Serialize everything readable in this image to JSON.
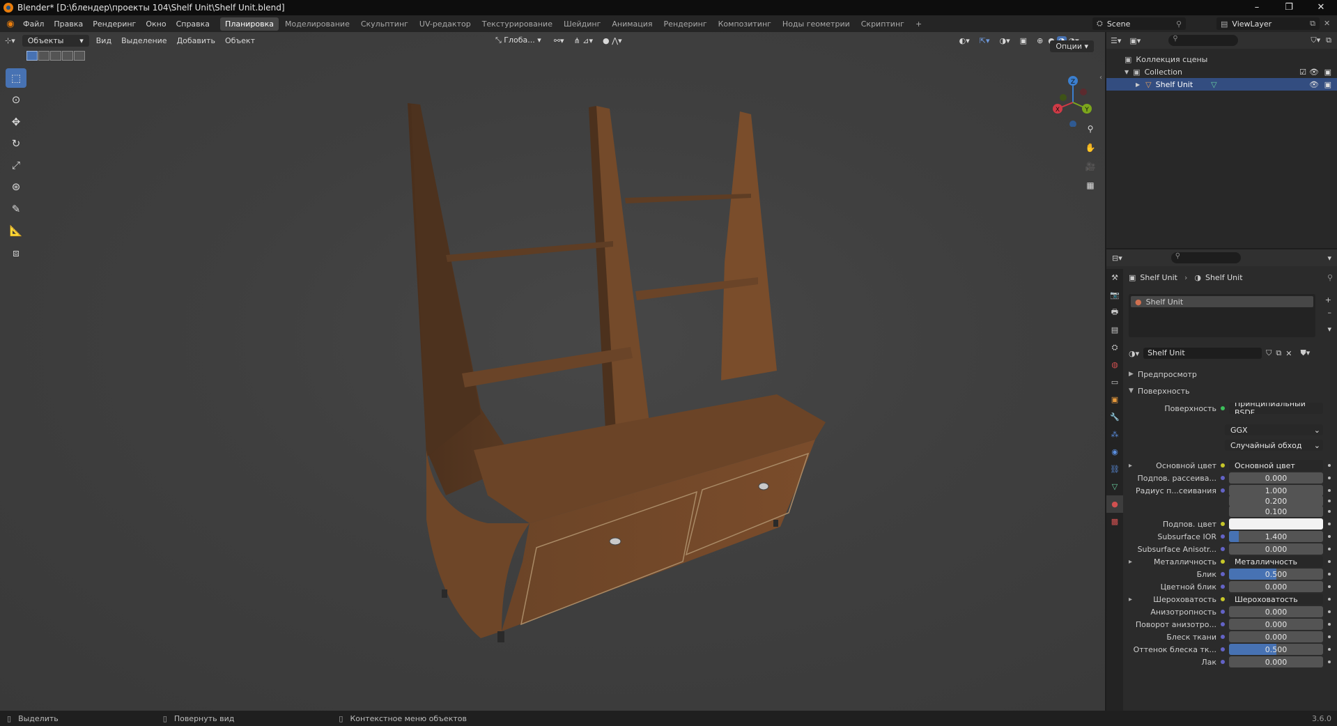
{
  "title": "Blender* [D:\\блендер\\проекты 104\\Shelf Unit\\Shelf Unit.blend]",
  "window_buttons": [
    "–",
    "❐",
    "✕"
  ],
  "menu": [
    "Файл",
    "Правка",
    "Рендеринг",
    "Окно",
    "Справка"
  ],
  "workspaces": [
    "Планировка",
    "Моделирование",
    "Скульптинг",
    "UV-редактор",
    "Текстурирование",
    "Шейдинг",
    "Анимация",
    "Рендеринг",
    "Композитинг",
    "Ноды геометрии",
    "Скриптинг",
    "+"
  ],
  "active_workspace_index": 0,
  "scene": {
    "name": "Scene",
    "view_layer": "ViewLayer"
  },
  "viewport": {
    "mode": "Объекты",
    "menus": [
      "Вид",
      "Выделение",
      "Добавить",
      "Объект"
    ],
    "transform_orientation": "Глоба...",
    "options_label": "Опции",
    "gizmo_axes": {
      "x": "X",
      "y": "Y",
      "z": "Z"
    },
    "colors": {
      "x": "#d03a46",
      "y": "#7ca61c",
      "z": "#3b7fcf"
    }
  },
  "tools": [
    "select-box-icon",
    "cursor-icon",
    "move-icon",
    "rotate-icon",
    "scale-icon",
    "transform-icon",
    "annotate-icon",
    "measure-icon",
    "add-cube-icon"
  ],
  "outliner": {
    "root": "Коллекция сцены",
    "collection": "Collection",
    "object": "Shelf Unit"
  },
  "properties": {
    "breadcrumb": [
      "Shelf Unit",
      "Shelf Unit"
    ],
    "material_slot": "Shelf Unit",
    "material_name": "Shelf Unit",
    "panels": {
      "preview": "Предпросмотр",
      "surface": "Поверхность"
    },
    "surface_label": "Поверхность",
    "surface_shader": "Принципиальный BSDF",
    "distribution": "GGX",
    "subsurface_method": "Случайный обход",
    "rows": [
      {
        "label": "Основной цвет",
        "value": "Основной цвет",
        "type": "link",
        "expand": true
      },
      {
        "label": "Подпов. рассеива...",
        "value": "0.000",
        "type": "num",
        "fill": 0
      },
      {
        "label": "Радиус п...сеивания",
        "value": "1.000",
        "type": "num",
        "fill": 0
      },
      {
        "label": "",
        "value": "0.200",
        "type": "num",
        "fill": 0
      },
      {
        "label": "",
        "value": "0.100",
        "type": "num",
        "fill": 0
      },
      {
        "label": "Подпов. цвет",
        "value": "",
        "type": "color",
        "fill": 0
      },
      {
        "label": "Subsurface IOR",
        "value": "1.400",
        "type": "num",
        "fill": 0.1
      },
      {
        "label": "Subsurface Anisotr...",
        "value": "0.000",
        "type": "num",
        "fill": 0
      },
      {
        "label": "Металличность",
        "value": "Металличность",
        "type": "link",
        "expand": true
      },
      {
        "label": "Блик",
        "value": "0.500",
        "type": "num",
        "fill": 0.5
      },
      {
        "label": "Цветной блик",
        "value": "0.000",
        "type": "num",
        "fill": 0
      },
      {
        "label": "Шероховатость",
        "value": "Шероховатость",
        "type": "link",
        "expand": true
      },
      {
        "label": "Анизотропность",
        "value": "0.000",
        "type": "num",
        "fill": 0
      },
      {
        "label": "Поворот анизотро...",
        "value": "0.000",
        "type": "num",
        "fill": 0
      },
      {
        "label": "Блеск ткани",
        "value": "0.000",
        "type": "num",
        "fill": 0
      },
      {
        "label": "Оттенок блеска тк...",
        "value": "0.500",
        "type": "num",
        "fill": 0.5
      },
      {
        "label": "Лак",
        "value": "0.000",
        "type": "num",
        "fill": 0
      }
    ]
  },
  "status": {
    "left": "Выделить",
    "middle": "Повернуть вид",
    "right": "Контекстное меню объектов",
    "version": "3.6.0"
  }
}
